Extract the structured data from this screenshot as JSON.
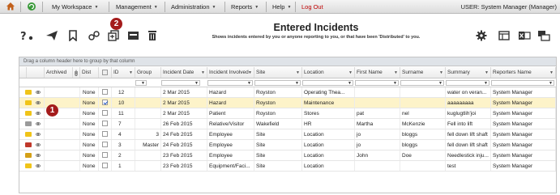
{
  "menu": {
    "workspace": "My Workspace",
    "management": "Management",
    "administration": "Administration",
    "reports": "Reports",
    "help": "Help",
    "logout": "Log Out",
    "user": "USER: System Manager (Manager)"
  },
  "toolbar": {
    "title": "Entered Incidents",
    "subtitle": "Shows incidents entered by you or anyone reporting to you, or that have been 'Distributed' to you."
  },
  "grid": {
    "group_hint": "Drag a column header here to group by that column",
    "columns": [
      "Archived",
      "",
      "Dist",
      "",
      "ID",
      "Group",
      "Incident Date",
      "Incident Involved",
      "Site",
      "Location",
      "First Name",
      "Surname",
      "Summary",
      "Reporters Name"
    ],
    "rows": [
      {
        "dist": "None",
        "checked": false,
        "id": "12",
        "group": "",
        "date": "2 Mar 2015",
        "involved": "Hazard",
        "site": "Royston",
        "location": "Operating Thea...",
        "first": "",
        "surname": "",
        "summary": "water on veran...",
        "reporter": "System Manager",
        "status_color": "#f0c419"
      },
      {
        "dist": "None",
        "checked": true,
        "id": "10",
        "group": "",
        "date": "2 Mar 2015",
        "involved": "Hazard",
        "site": "Royston",
        "location": "Maintenance",
        "first": "",
        "surname": "",
        "summary": "aaaaaaaaa",
        "reporter": "System Manager",
        "status_color": "#f0c419"
      },
      {
        "dist": "None",
        "checked": false,
        "id": "11",
        "group": "",
        "date": "2 Mar 2015",
        "involved": "Patient",
        "site": "Royston",
        "location": "Stores",
        "first": "pat",
        "surname": "nel",
        "summary": "kuglugtlih'joi",
        "reporter": "System Manager",
        "status_color": "#f0c419"
      },
      {
        "dist": "None",
        "checked": false,
        "id": "7",
        "group": "",
        "date": "26 Feb 2015",
        "involved": "Relative/Visitor",
        "site": "Wakefield",
        "location": "HR",
        "first": "Martha",
        "surname": "McKenzie",
        "summary": "Fell into lift",
        "reporter": "System Manager",
        "status_color": "#9a9a9a"
      },
      {
        "dist": "None",
        "checked": false,
        "id": "4",
        "group": "3",
        "date": "24 Feb 2015",
        "involved": "Employee",
        "site": "Site",
        "location": "Location",
        "first": "jo",
        "surname": "bloggs",
        "summary": "fell down lift shaft",
        "reporter": "System Manager",
        "status_color": "#f0c419"
      },
      {
        "dist": "None",
        "checked": false,
        "id": "3",
        "group": "Master",
        "date": "24 Feb 2015",
        "involved": "Employee",
        "site": "Site",
        "location": "Location",
        "first": "jo",
        "surname": "bloggs",
        "summary": "fell down lift shaft",
        "reporter": "System Manager",
        "status_color": "#c0392b"
      },
      {
        "dist": "None",
        "checked": false,
        "id": "2",
        "group": "",
        "date": "23 Feb 2015",
        "involved": "Employee",
        "site": "Site",
        "location": "Location",
        "first": "John",
        "surname": "Doe",
        "summary": "Needlestick inju...",
        "reporter": "System Manager",
        "status_color": "#d4a017"
      },
      {
        "dist": "None",
        "checked": false,
        "id": "1",
        "group": "",
        "date": "23 Feb 2015",
        "involved": "Equipment/Faci...",
        "site": "Site",
        "location": "Location",
        "first": "",
        "surname": "",
        "summary": "test",
        "reporter": "System Manager",
        "status_color": "#f0c419"
      }
    ]
  },
  "badges": {
    "one": "1",
    "two": "2"
  },
  "colors": {
    "badge": "#a41b1b",
    "selected_row": "#fdf3c9",
    "link": "#1a3fbf",
    "logout": "#c00000"
  },
  "icons": [
    "home-icon",
    "refresh-icon",
    "question-icon",
    "send-icon",
    "bookmark-icon",
    "link-icon",
    "copy-icon",
    "inbox-icon",
    "trash-icon",
    "gear-icon",
    "grid-icon",
    "excel-icon",
    "columns-icon"
  ]
}
